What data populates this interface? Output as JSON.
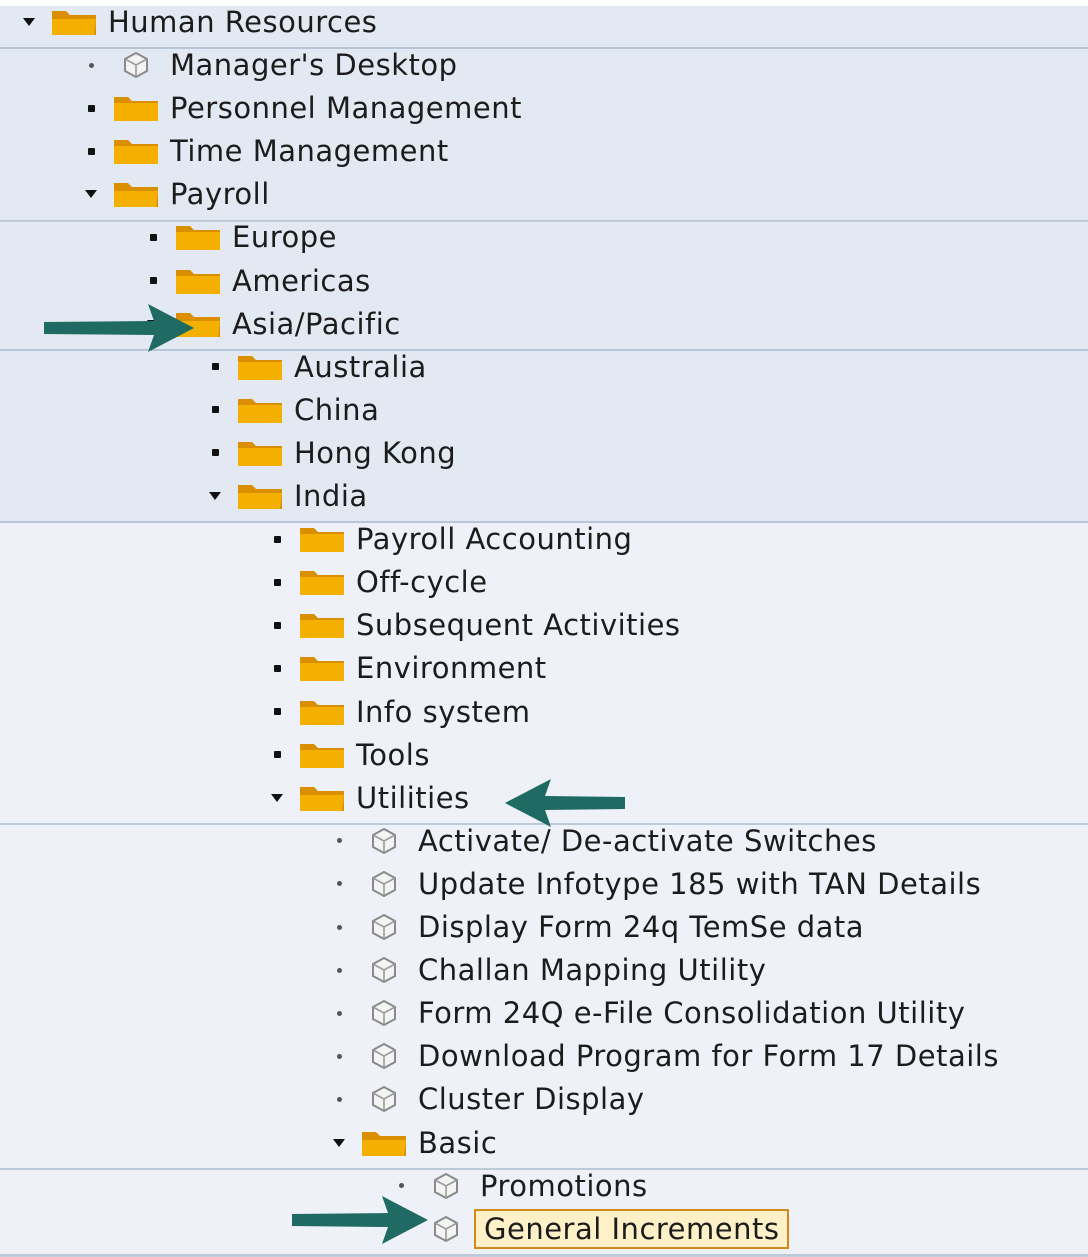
{
  "colors": {
    "band_dark": "#e2e9f2",
    "band_light": "#eef2f8",
    "separator": "#93a8bf",
    "folder": "#f3b000",
    "folder_dark": "#d98f00",
    "selection_border": "#d08a1e",
    "selection_fill": "#fff1c7",
    "arrow": "#1f6a62"
  },
  "tree": {
    "rows": [
      {
        "label": "Human Resources",
        "type": "folder",
        "state": "expanded",
        "level": 0
      },
      {
        "label": "Manager's Desktop",
        "type": "transaction",
        "state": "leaf",
        "level": 1
      },
      {
        "label": "Personnel Management",
        "type": "folder",
        "state": "collapsed",
        "level": 1
      },
      {
        "label": "Time Management",
        "type": "folder",
        "state": "collapsed",
        "level": 1
      },
      {
        "label": "Payroll",
        "type": "folder",
        "state": "expanded",
        "level": 1
      },
      {
        "label": "Europe",
        "type": "folder",
        "state": "collapsed",
        "level": 2
      },
      {
        "label": "Americas",
        "type": "folder",
        "state": "collapsed",
        "level": 2
      },
      {
        "label": "Asia/Pacific",
        "type": "folder",
        "state": "expanded",
        "level": 2
      },
      {
        "label": "Australia",
        "type": "folder",
        "state": "collapsed",
        "level": 3
      },
      {
        "label": "China",
        "type": "folder",
        "state": "collapsed",
        "level": 3
      },
      {
        "label": "Hong Kong",
        "type": "folder",
        "state": "collapsed",
        "level": 3
      },
      {
        "label": "India",
        "type": "folder",
        "state": "expanded",
        "level": 3
      },
      {
        "label": "Payroll Accounting",
        "type": "folder",
        "state": "collapsed",
        "level": 4
      },
      {
        "label": "Off-cycle",
        "type": "folder",
        "state": "collapsed",
        "level": 4
      },
      {
        "label": "Subsequent Activities",
        "type": "folder",
        "state": "collapsed",
        "level": 4
      },
      {
        "label": "Environment",
        "type": "folder",
        "state": "collapsed",
        "level": 4
      },
      {
        "label": "Info system",
        "type": "folder",
        "state": "collapsed",
        "level": 4
      },
      {
        "label": "Tools",
        "type": "folder",
        "state": "collapsed",
        "level": 4
      },
      {
        "label": "Utilities",
        "type": "folder",
        "state": "expanded",
        "level": 4
      },
      {
        "label": "Activate/ De-activate Switches",
        "type": "transaction",
        "state": "leaf",
        "level": 5
      },
      {
        "label": "Update Infotype 185 with TAN Details",
        "type": "transaction",
        "state": "leaf",
        "level": 5
      },
      {
        "label": "Display Form 24q TemSe data",
        "type": "transaction",
        "state": "leaf",
        "level": 5
      },
      {
        "label": "Challan Mapping Utility",
        "type": "transaction",
        "state": "leaf",
        "level": 5
      },
      {
        "label": "Form 24Q e-File Consolidation Utility",
        "type": "transaction",
        "state": "leaf",
        "level": 5
      },
      {
        "label": "Download Program for Form 17 Details",
        "type": "transaction",
        "state": "leaf",
        "level": 5
      },
      {
        "label": "Cluster Display",
        "type": "transaction",
        "state": "leaf",
        "level": 5
      },
      {
        "label": "Basic",
        "type": "folder",
        "state": "expanded",
        "level": 5
      },
      {
        "label": "Promotions",
        "type": "transaction",
        "state": "leaf",
        "level": 6
      },
      {
        "label": "General Increments",
        "type": "transaction",
        "state": "leaf",
        "level": 6,
        "selected": true
      }
    ]
  }
}
